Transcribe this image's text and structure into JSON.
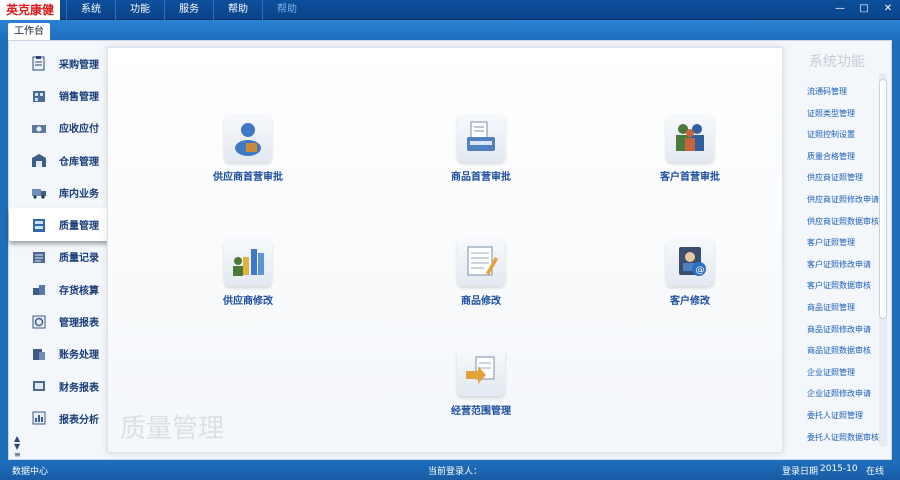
{
  "app": {
    "logo": "英克康健",
    "menu": [
      "系统",
      "功能",
      "服务",
      "帮助",
      "帮助"
    ]
  },
  "tab": {
    "label": "工作台"
  },
  "leftnav": {
    "items": [
      {
        "label": "采购管理",
        "icon": "clipboard-icon"
      },
      {
        "label": "销售管理",
        "icon": "building-icon"
      },
      {
        "label": "应收应付",
        "icon": "money-icon"
      },
      {
        "label": "仓库管理",
        "icon": "warehouse-icon"
      },
      {
        "label": "库内业务",
        "icon": "truck-icon"
      },
      {
        "label": "质量管理",
        "icon": "quality-icon"
      },
      {
        "label": "质量记录",
        "icon": "record-icon"
      },
      {
        "label": "存货核算",
        "icon": "inventory-icon"
      },
      {
        "label": "管理报表",
        "icon": "report-icon"
      },
      {
        "label": "账务处理",
        "icon": "accounting-icon"
      },
      {
        "label": "财务报表",
        "icon": "finance-report-icon"
      },
      {
        "label": "报表分析",
        "icon": "analysis-icon"
      }
    ],
    "active_index": 5
  },
  "main": {
    "watermark": "质量管理",
    "tiles": [
      {
        "label": "供应商首营审批",
        "icon": "supplier-approval-icon"
      },
      {
        "label": "商品首营审批",
        "icon": "product-approval-icon"
      },
      {
        "label": "客户首营审批",
        "icon": "customer-approval-icon"
      },
      {
        "label": "供应商修改",
        "icon": "supplier-edit-icon"
      },
      {
        "label": "商品修改",
        "icon": "product-edit-icon"
      },
      {
        "label": "客户修改",
        "icon": "customer-edit-icon"
      },
      {
        "label": "经营范围管理",
        "icon": "business-scope-icon"
      }
    ]
  },
  "rightpanel": {
    "title": "系统功能",
    "items": [
      "流通码管理",
      "证照类型管理",
      "证照控制设置",
      "质量合格管理",
      "供应商证照管理",
      "供应商证照修改申请",
      "供应商证照数据审核",
      "客户证照管理",
      "客户证照修改申请",
      "客户证照数据审核",
      "商品证照管理",
      "商品证照修改申请",
      "商品证照数据审核",
      "企业证照管理",
      "企业证照修改申请",
      "委托人证照管理",
      "委托人证照数据审核"
    ]
  },
  "statusbar": {
    "left": "数据中心",
    "center": "当前登录人：",
    "login_label": "登录日期",
    "date": "2015-10",
    "right": "在线"
  }
}
